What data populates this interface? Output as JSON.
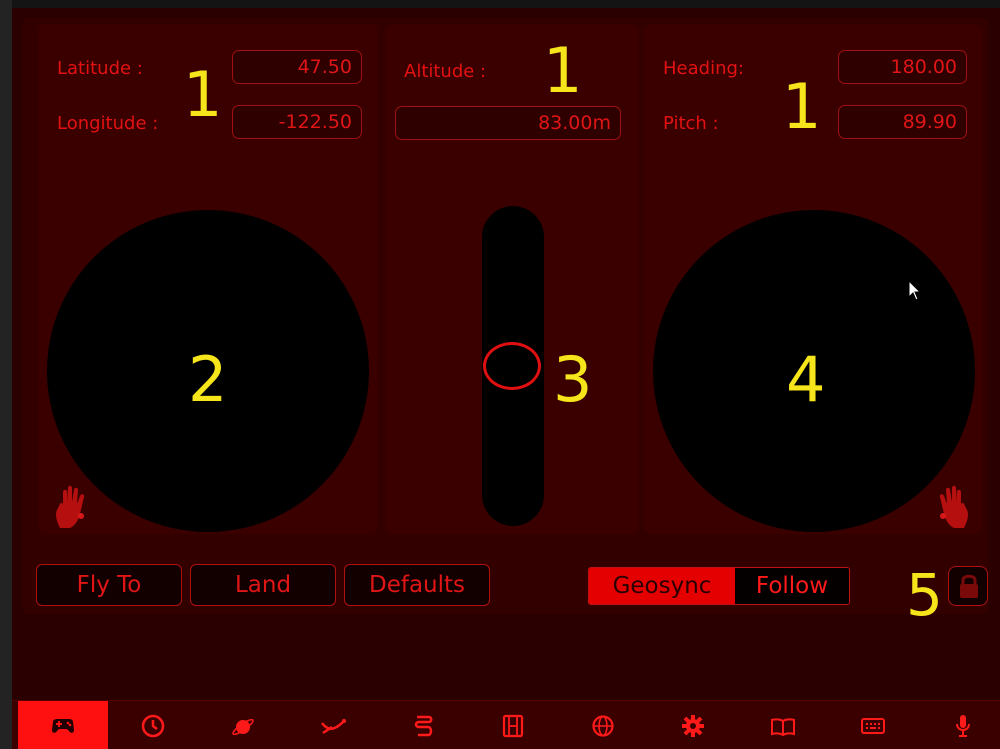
{
  "left_panel": {
    "latitude_label": "Latitude :",
    "latitude_value": "47.50",
    "longitude_label": "Longitude :",
    "longitude_value": "-122.50"
  },
  "middle_panel": {
    "altitude_label": "Altitude :",
    "altitude_value": "83.00m"
  },
  "right_panel": {
    "heading_label": "Heading:",
    "heading_value": "180.00",
    "pitch_label": "Pitch :",
    "pitch_value": "89.90"
  },
  "annotations": {
    "n1": "1",
    "n2": "2",
    "n3": "3",
    "n4": "4",
    "n5": "5"
  },
  "buttons": {
    "fly_to": "Fly To",
    "land": "Land",
    "defaults": "Defaults"
  },
  "mode_toggle": {
    "geosync": "Geosync",
    "follow": "Follow",
    "selected": "Geosync"
  },
  "altitude_slider": {
    "level": 0.5
  },
  "tabbar": {
    "active_index": 0,
    "tabs": [
      {
        "icon": "gamepad-icon"
      },
      {
        "icon": "clock-icon"
      },
      {
        "icon": "planet-icon"
      },
      {
        "icon": "path-icon"
      },
      {
        "icon": "route-icon"
      },
      {
        "icon": "film-icon"
      },
      {
        "icon": "globe-icon"
      },
      {
        "icon": "gear-icon"
      },
      {
        "icon": "book-icon"
      },
      {
        "icon": "keyboard-icon"
      },
      {
        "icon": "microphone-icon"
      }
    ]
  },
  "colors": {
    "accent": "#e31212",
    "annotation": "#f5e51a",
    "background": "#2a0000"
  }
}
